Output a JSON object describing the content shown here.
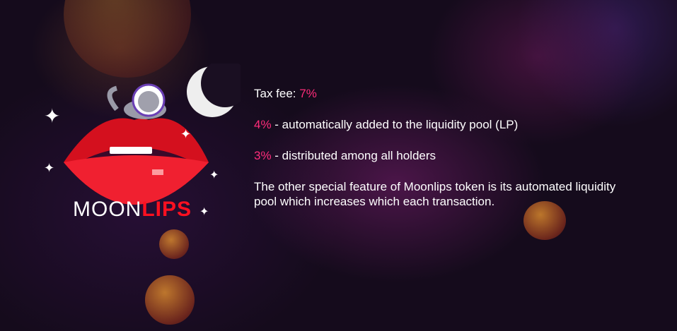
{
  "logo": {
    "brand_part1": "MOON",
    "brand_part2": "LIPS"
  },
  "content": {
    "tax_label": "Tax fee:",
    "tax_value": "7%",
    "lp_value": "4%",
    "lp_text": " - automatically added to the liquidity pool (LP)",
    "holders_value": "3%",
    "holders_text": " - distributed among all holders",
    "description": "The other special feature of Moonlips token is its automated liquidity pool which increases which each transaction."
  },
  "colors": {
    "accent": "#ff2c7a",
    "brand_red": "#ff1020"
  }
}
